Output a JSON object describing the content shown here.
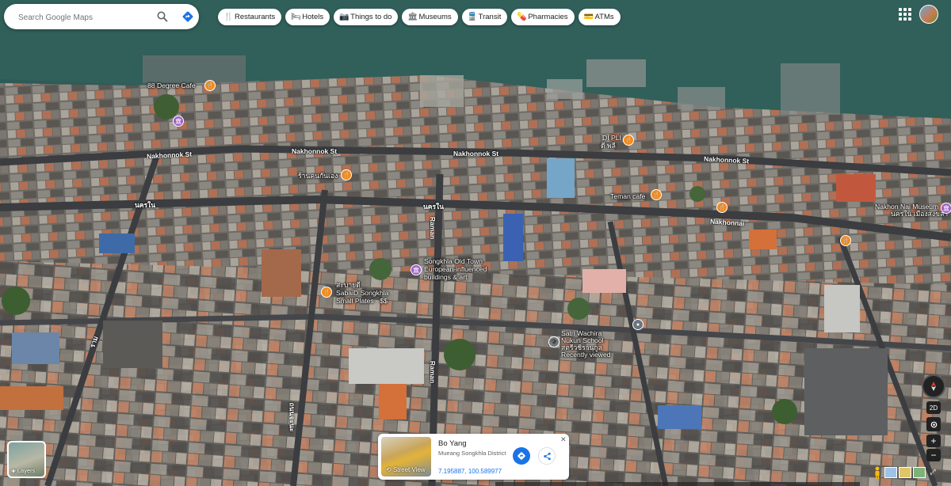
{
  "search": {
    "placeholder": "Search Google Maps"
  },
  "icons": {
    "search": "search-icon",
    "directions": "directions-icon",
    "apps": "apps-grid-icon",
    "layers": "layers-icon",
    "pegman": "pegman-icon",
    "share": "share-icon",
    "close": "close-icon"
  },
  "chips": [
    {
      "label": "Restaurants",
      "icon": "🍴"
    },
    {
      "label": "Hotels",
      "icon": "🛏"
    },
    {
      "label": "Things to do",
      "icon": "📷"
    },
    {
      "label": "Museums",
      "icon": "🏛"
    },
    {
      "label": "Transit",
      "icon": "🚆"
    },
    {
      "label": "Pharmacies",
      "icon": "💊"
    },
    {
      "label": "ATMs",
      "icon": "💳"
    }
  ],
  "places": {
    "degree_cafe": "88 Degree Cafe",
    "di_pli": "DI PLI",
    "di_pli_sub": "ดี พลี",
    "ran_nam": "ร้านคนกันเอง",
    "teman_cafe": "Teman cafe",
    "nakhon_nai_museum": "Nakhon Nai Museum",
    "nakhon_nai_museum_sub": "นครใน เมืองสงขลา",
    "old_town": "Songkhla Old Town",
    "old_town_sub1": "European-influenced",
    "old_town_sub2": "buildings & art",
    "sabaid_th": "สะบายดี",
    "sabaid": "SabaiD Songkhla",
    "sabaid_sub": "Small Plates · $$",
    "school": "Satri Wachira",
    "school2": "Nukun School",
    "school_th": "สตรีวชิรานุกูล",
    "school_sub": "Recently viewed"
  },
  "roads": {
    "nakhonnok1": "Nakhonnok St",
    "nakhonnok2": "Nakhonnok St",
    "nakhonnok3": "Nakhonnok St",
    "nakhonnok4": "Nakhonnok St",
    "nakhonnai_th": "นครใน",
    "nakhonnai_th2": "นครใน",
    "nakhonnai": "Nakhonnai",
    "ramwithi": "Raman",
    "ramwithi2": "Raman",
    "thai_left": "ราม",
    "thai_mid": "ถนนจะนะ"
  },
  "controls": {
    "view_2d": "2D",
    "zoom_in": "+",
    "zoom_out": "−",
    "layers_label": "Layers"
  },
  "place_card": {
    "title": "Bo Yang",
    "address": "Mueang Songkhla District",
    "coordinates": "7.195887, 100.589977",
    "street_view_label": "Street View"
  },
  "colors": {
    "water": "#2e5b57",
    "accent": "#1a73e8",
    "food_pin": "#f28b1e",
    "museum_pin": "#9c5fc4"
  }
}
